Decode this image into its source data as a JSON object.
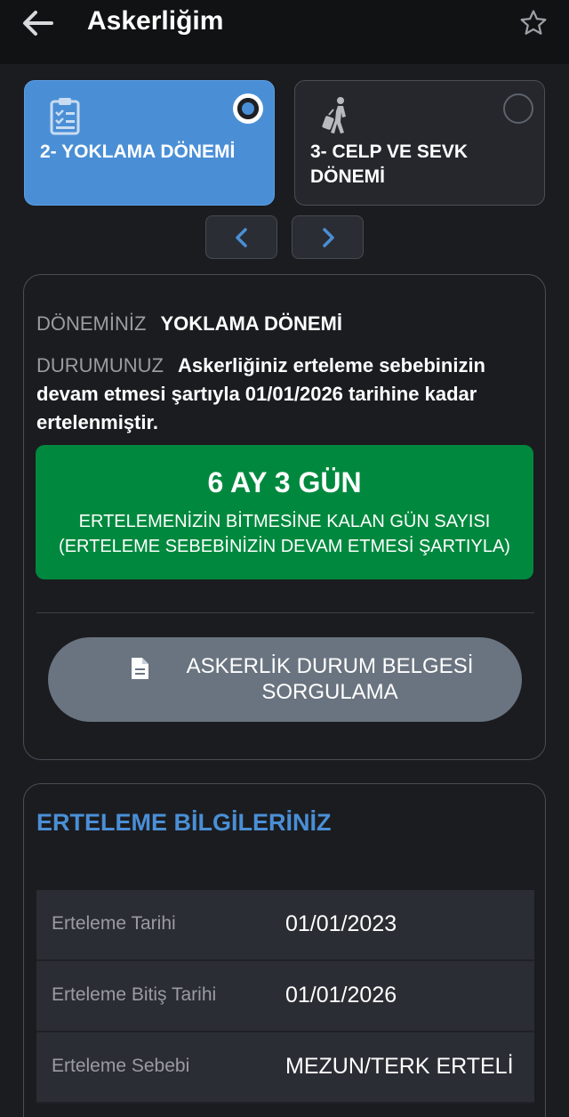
{
  "header": {
    "title": "Askerliğim",
    "back_icon": "arrow-left-icon",
    "favorite_icon": "star-outline-icon"
  },
  "periods": [
    {
      "label": "2- YOKLAMA DÖNEMİ",
      "icon": "clipboard-checklist-icon",
      "selected": true
    },
    {
      "label": "3- CELP VE SEVK DÖNEMİ",
      "icon": "traveler-luggage-icon",
      "selected": false
    }
  ],
  "nav": {
    "prev_icon": "chevron-left-icon",
    "next_icon": "chevron-right-icon"
  },
  "status": {
    "period_label": "DÖNEMİNİZ",
    "period_value": "YOKLAMA DÖNEMİ",
    "status_label": "DURUMUNUZ",
    "status_value": "Askerliğiniz erteleme sebebinizin devam etmesi şartıyla 01/01/2026 tarihine kadar ertelenmiştir.",
    "remaining": "6 AY 3 GÜN",
    "remaining_caption_1": "ERTELEMENİZİN BİTMESİNE KALAN GÜN SAYISI",
    "remaining_caption_2": "(ERTELEME SEBEBİNİZİN DEVAM ETMESİ ŞARTIYLA)",
    "doc_button_line1": "ASKERLİK DURUM BELGESİ",
    "doc_button_line2": "SORGULAMA",
    "doc_icon": "document-icon"
  },
  "deferral": {
    "title": "ERTELEME BİLGİLERİNİZ",
    "rows": [
      {
        "label": "Erteleme Tarihi",
        "value": "01/01/2023"
      },
      {
        "label": "Erteleme Bitiş Tarihi",
        "value": "01/01/2026"
      },
      {
        "label": "Erteleme Sebebi",
        "value": "MEZUN/TERK ERTELİ"
      }
    ]
  },
  "colors": {
    "accent": "#4a8fd6",
    "success": "#00893e",
    "background": "#1b1c20",
    "button_gray": "#6a7480"
  }
}
